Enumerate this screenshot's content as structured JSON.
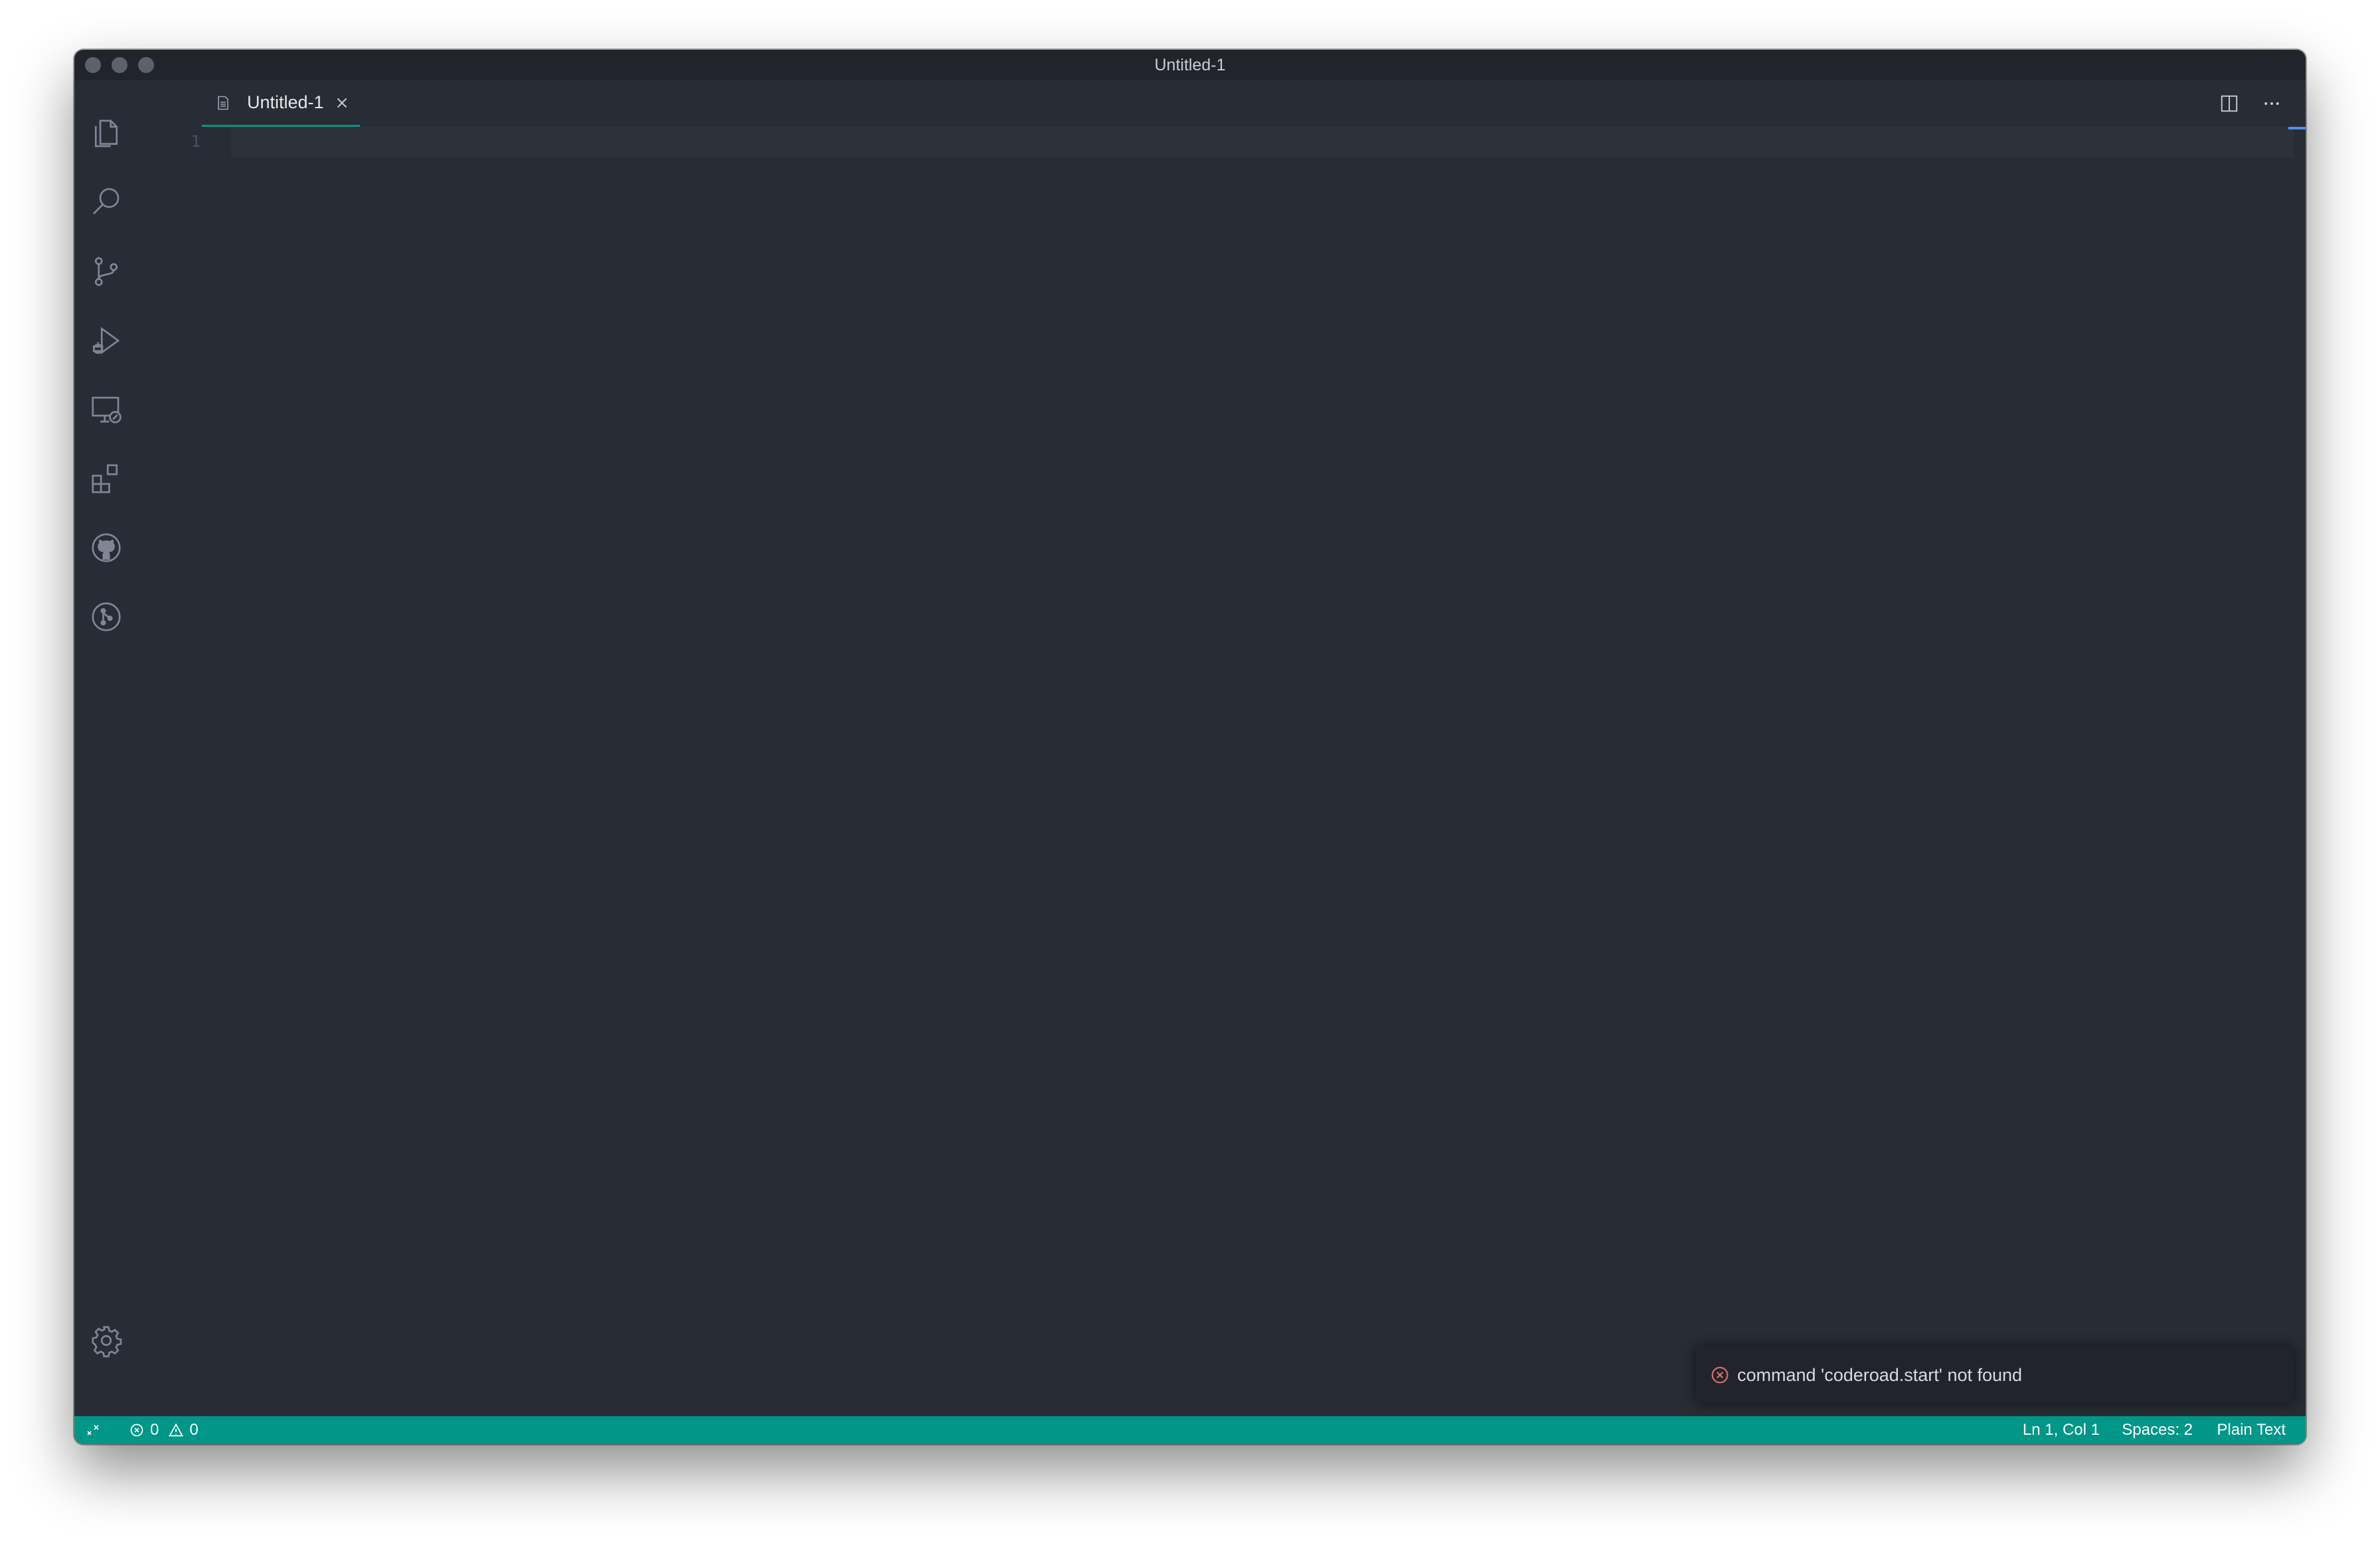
{
  "window": {
    "title": "Untitled-1"
  },
  "activity_bar": {
    "items": [
      {
        "name": "explorer",
        "icon": "files-icon"
      },
      {
        "name": "search",
        "icon": "search-icon"
      },
      {
        "name": "source-control",
        "icon": "source-control-icon"
      },
      {
        "name": "run-and-debug",
        "icon": "run-debug-icon"
      },
      {
        "name": "remote-explorer",
        "icon": "remote-explorer-icon"
      },
      {
        "name": "extensions",
        "icon": "extensions-icon"
      },
      {
        "name": "github",
        "icon": "github-icon"
      },
      {
        "name": "git-graph",
        "icon": "git-graph-icon"
      }
    ],
    "bottom": {
      "name": "manage",
      "icon": "gear-icon"
    }
  },
  "tabs": [
    {
      "label": "Untitled-1",
      "icon": "file-icon",
      "active": true
    }
  ],
  "editor": {
    "line_numbers": [
      "1"
    ],
    "content": ""
  },
  "status_bar": {
    "errors": "0",
    "warnings": "0",
    "cursor_position": "Ln 1, Col 1",
    "indentation": "Spaces: 2",
    "language": "Plain Text"
  },
  "notification": {
    "message": "command 'coderoad.start' not found",
    "severity": "error"
  },
  "colors": {
    "accent": "#009688",
    "editor_bg": "#282c34",
    "error": "#e06c75"
  }
}
